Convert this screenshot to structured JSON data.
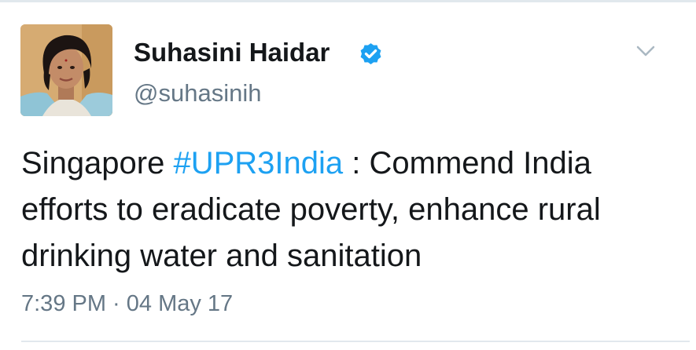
{
  "tweet": {
    "author": {
      "name": "Suhasini Haidar",
      "handle": "@suhasinih",
      "verified": true,
      "avatar": "profile-photo"
    },
    "text": {
      "before_hashtag": "Singapore ",
      "hashtag": "#UPR3India",
      "after_hashtag": " : Commend India efforts to eradicate poverty, enhance rural drinking water and sanitation"
    },
    "timestamp": "7:39 PM · 04 May 17",
    "menu_icon": "chevron-down-icon"
  },
  "colors": {
    "accent": "#1da1f2",
    "name_text": "#14171a",
    "secondary_text": "#657786",
    "divider": "#e1e8ed",
    "chevron": "#aab8c2"
  }
}
